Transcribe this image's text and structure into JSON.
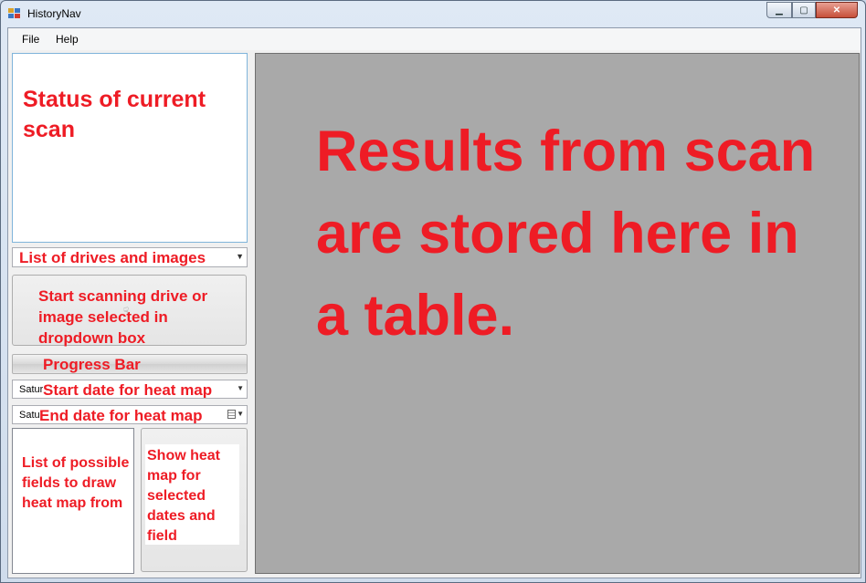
{
  "window": {
    "title": "HistoryNav",
    "min_icon": "minimize-icon",
    "max_icon": "maximize-icon",
    "close_icon": "close-icon",
    "min_glyph": "▁",
    "max_glyph": "▢",
    "close_glyph": "✕"
  },
  "menu": {
    "file": "File",
    "help": "Help"
  },
  "status_panel": {
    "text": "Status of current scan"
  },
  "drives_combo": {
    "label": "List of drives and images",
    "arrow": "▼"
  },
  "scan_button": {
    "label": "Start scanning drive or image selected in dropdown box"
  },
  "progress_bar": {
    "label": "Progress Bar"
  },
  "start_date": {
    "value": "Saturday",
    "label": "Start date for heat map",
    "arrow": "▼"
  },
  "end_date": {
    "value": "Saturday",
    "label": "End date for heat map",
    "arrow": "▼"
  },
  "fields_list": {
    "label": "List of possible fields to draw heat map from"
  },
  "show_map_button": {
    "label": "Show heat map for selected dates and field"
  },
  "results_area": {
    "label": "Results from scan are stored here in a table."
  },
  "colors": {
    "annotation_red": "#ee1c25",
    "results_gray": "#a9a9a9"
  }
}
